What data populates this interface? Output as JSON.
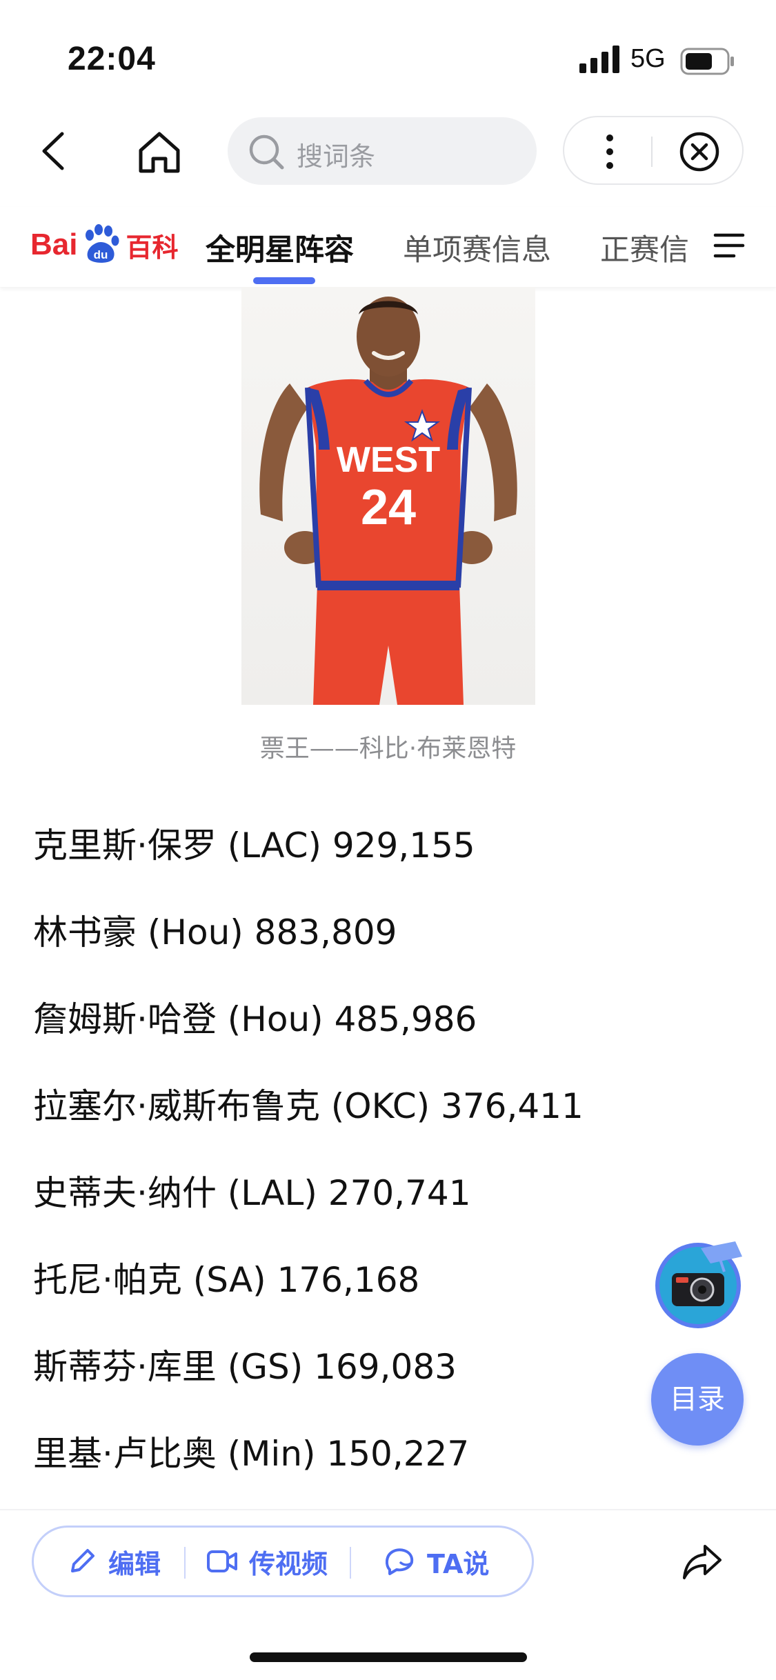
{
  "status_bar": {
    "time": "22:04",
    "network": "5G"
  },
  "nav": {
    "back_icon": "chevron-left-icon",
    "home_icon": "home-icon",
    "search_placeholder": "搜词条",
    "more_icon": "more-vertical-icon",
    "close_icon": "close-circle-icon"
  },
  "logo": {
    "part1": "Bai",
    "part2": "du",
    "part3": "百科"
  },
  "tabs": [
    {
      "label": "全明星阵容",
      "active": true
    },
    {
      "label": "单项赛信息",
      "active": false
    },
    {
      "label": "正赛信",
      "active": false
    }
  ],
  "figure": {
    "caption": "票王——科比·布莱恩特",
    "jersey_text": "WEST",
    "jersey_number": "24"
  },
  "votes": [
    "克里斯·保罗 (LAC) 929,155",
    "林书豪 (Hou) 883,809",
    "詹姆斯·哈登 (Hou) 485,986",
    "拉塞尔·威斯布鲁克 (OKC) 376,411",
    "史蒂夫·纳什 (LAL) 270,741",
    "托尼·帕克 (SA) 176,168",
    "斯蒂芬·库里 (GS) 169,083",
    "里基·卢比奥 (Min) 150,227"
  ],
  "floating": {
    "toc_label": "目录"
  },
  "bottom_bar": {
    "edit_label": "编辑",
    "video_label": "传视频",
    "ta_label": "TA说"
  },
  "colors": {
    "accent": "#4e6ef2",
    "brand_red": "#e7272f",
    "toc_bg": "#6f8ef5"
  }
}
